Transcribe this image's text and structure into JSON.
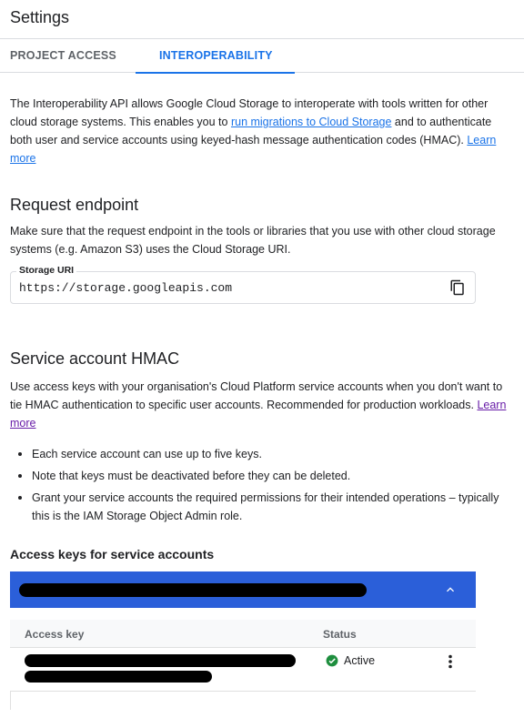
{
  "header": {
    "title": "Settings"
  },
  "tabs": [
    {
      "label": "PROJECT ACCESS",
      "active": false
    },
    {
      "label": "INTEROPERABILITY",
      "active": true
    }
  ],
  "intro": {
    "text_1": "The Interoperability API allows Google Cloud Storage to interoperate with tools written for other cloud storage systems. This enables you to ",
    "link_migrations": "run migrations to Cloud Storage",
    "text_2": " and to authenticate both user and service accounts using keyed-hash message authentication codes (HMAC). ",
    "link_learn_more": "Learn more"
  },
  "request_endpoint": {
    "title": "Request endpoint",
    "description": "Make sure that the request endpoint in the tools or libraries that you use with other cloud storage systems (e.g. Amazon S3) uses the Cloud Storage URI.",
    "field_label": "Storage URI",
    "field_value": "https://storage.googleapis.com",
    "copy_icon": "copy-icon"
  },
  "service_account_hmac": {
    "title": "Service account HMAC",
    "description": "Use access keys with your organisation's Cloud Platform service accounts when you don't want to tie HMAC authentication to specific user accounts. Recommended for production workloads. ",
    "link_learn_more": "Learn more",
    "bullets": [
      "Each service account can use up to five keys.",
      "Note that keys must be deactivated before they can be deleted.",
      "Grant your service accounts the required permissions for their intended operations – typically this is the IAM Storage Object Admin role."
    ]
  },
  "access_keys": {
    "title": "Access keys for service accounts",
    "panel_color": "#2b5fd9",
    "columns": {
      "key": "Access key",
      "status": "Status"
    },
    "rows": [
      {
        "status": "Active",
        "status_color": "#1e8e3e"
      }
    ]
  }
}
